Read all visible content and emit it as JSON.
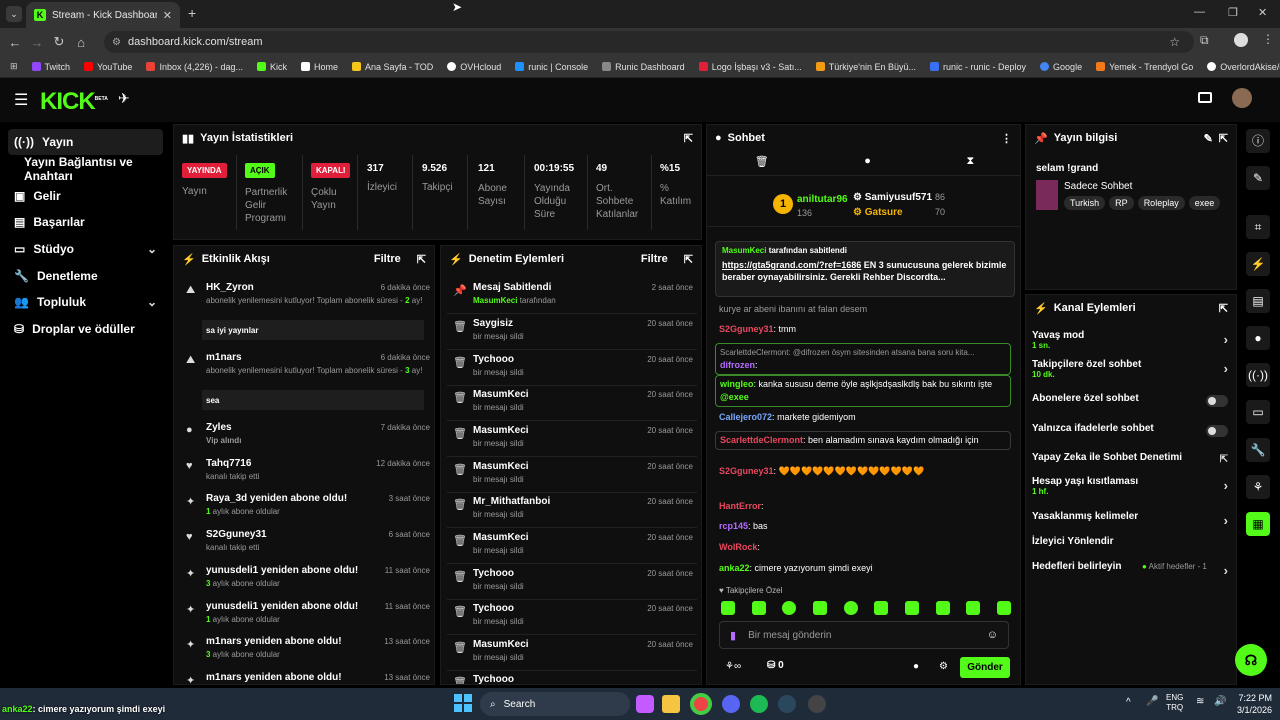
{
  "browser": {
    "tab_title": "Stream - Kick Dashboard",
    "url": "dashboard.kick.com/stream",
    "bookmarks": [
      "Twitch",
      "YouTube",
      "Inbox (4,226) - dag...",
      "Kick",
      "Home",
      "Ana Sayfa - TOD",
      "OVHcloud",
      "runic | Console",
      "Runic Dashboard",
      "Logo İşbaşı v3 - Satı...",
      "Türkiye'nin En Büyü...",
      "runic - runic - Deploy",
      "Google",
      "Yemek - Trendyol Go",
      "OverlordAkise/gmo..."
    ]
  },
  "kick": {
    "logo": "KICK",
    "logo_sup": "BETA"
  },
  "sidebar": {
    "items": [
      {
        "label": "Yayın",
        "icon": "broadcast-icon"
      },
      {
        "label": "Yayın Bağlantısı ve Anahtarı"
      },
      {
        "label": "Gelir",
        "icon": "revenue-icon"
      },
      {
        "label": "Başarılar",
        "icon": "achievements-icon"
      },
      {
        "label": "Stüdyo",
        "icon": "studio-icon"
      },
      {
        "label": "Denetleme",
        "icon": "wrench-icon"
      },
      {
        "label": "Topluluk",
        "icon": "community-icon"
      },
      {
        "label": "Droplar ve ödüller",
        "icon": "drops-icon"
      }
    ]
  },
  "stats": {
    "title": "Yayın İstatistikleri",
    "items": [
      {
        "badge": "YAYINDA",
        "badge_color": "#e21f3a",
        "label": "Yayın"
      },
      {
        "badge": "AÇIK",
        "badge_color": "#53fc18",
        "label": "Partnerlik Gelir Programı"
      },
      {
        "badge": "KAPALI",
        "badge_color": "#e21f3a",
        "label": "Çoklu Yayın"
      },
      {
        "value": "317",
        "label": "İzleyici"
      },
      {
        "value": "9.526",
        "label": "Takipçi"
      },
      {
        "value": "121",
        "label": "Abone Sayısı"
      },
      {
        "value": "00:19:55",
        "label": "Yayında Olduğu Süre"
      },
      {
        "value": "49",
        "label": "Ort. Sohbete Katılanlar"
      },
      {
        "value": "%15",
        "label": "% Katılım"
      }
    ]
  },
  "activity": {
    "title": "Etkinlik Akışı",
    "filter": "Filtre",
    "events": [
      {
        "name": "HK_Zyron",
        "time": "6 dakika önce",
        "sub_a": "abonelik yenilemesini kutluyor! Toplam abonelik süresi - ",
        "sub_num": "2",
        "sub_b": " ay!",
        "message": "sa iyi yayınlar"
      },
      {
        "name": "m1nars",
        "time": "6 dakika önce",
        "sub_a": "abonelik yenilemesini kutluyor! Toplam abonelik süresi - ",
        "sub_num": "3",
        "sub_b": " ay!",
        "message": "sea"
      },
      {
        "name": "Zyles",
        "time": "7 dakika önce",
        "sub": "Vip alındı"
      },
      {
        "name": "Tahq7716",
        "time": "12 dakika önce",
        "sub": "kanalı takip etti"
      },
      {
        "name": "Raya_3d yeniden abone oldu!",
        "time": "3 saat önce",
        "sub_num": "1",
        "sub": " aylık abone oldular"
      },
      {
        "name": "S2Gguney31",
        "time": "6 saat önce",
        "sub": "kanalı takip etti"
      },
      {
        "name": "yunusdeli1 yeniden abone oldu!",
        "time": "11 saat önce",
        "sub_num": "3",
        "sub": " aylık abone oldular"
      },
      {
        "name": "yunusdeli1 yeniden abone oldu!",
        "time": "11 saat önce",
        "sub_num": "1",
        "sub": " aylık abone oldular"
      },
      {
        "name": "m1nars yeniden abone oldu!",
        "time": "13 saat önce",
        "sub_num": "3",
        "sub": " aylık abone oldular"
      },
      {
        "name": "m1nars yeniden abone oldu!",
        "time": "13 saat önce"
      }
    ]
  },
  "moderation": {
    "title": "Denetim Eylemleri",
    "filter": "Filtre",
    "items": [
      {
        "name": "Mesaj Sabitlendi",
        "time": "2 saat önce",
        "by": "MasumKeci",
        "sub": " tarafından"
      },
      {
        "name": "Saygisiz",
        "time": "20 saat önce",
        "sub": "bir mesajı sildi"
      },
      {
        "name": "Tychooo",
        "time": "20 saat önce",
        "sub": "bir mesajı sildi"
      },
      {
        "name": "MasumKeci",
        "time": "20 saat önce",
        "sub": "bir mesajı sildi"
      },
      {
        "name": "MasumKeci",
        "time": "20 saat önce",
        "sub": "bir mesajı sildi"
      },
      {
        "name": "MasumKeci",
        "time": "20 saat önce",
        "sub": "bir mesajı sildi"
      },
      {
        "name": "Mr_Mithatfanboi",
        "time": "20 saat önce",
        "sub": "bir mesajı sildi"
      },
      {
        "name": "MasumKeci",
        "time": "20 saat önce",
        "sub": "bir mesajı sildi"
      },
      {
        "name": "Tychooo",
        "time": "20 saat önce",
        "sub": "bir mesajı sildi"
      },
      {
        "name": "Tychooo",
        "time": "20 saat önce",
        "sub": "bir mesajı sildi"
      },
      {
        "name": "MasumKeci",
        "time": "20 saat önce",
        "sub": "bir mesajı sildi"
      },
      {
        "name": "Tychooo",
        "time": "",
        "sub": ""
      }
    ]
  },
  "chat": {
    "title": "Sohbet",
    "leaders": {
      "first": "aniltutar96",
      "first_count": "136",
      "second": "Samiyusuf571",
      "second_count": "86",
      "third": "Gatsure",
      "third_count": "70",
      "rank": "1"
    },
    "pinned": {
      "by": "MasumKeci",
      "by_suffix": " tarafından sabitlendi",
      "link": "https://gta5grand.com/?ref=1686",
      "text": " EN 3 sunucusuna gelerek bizimle beraber oynayabilirsiniz. Gerekli Rehber Discordta..."
    },
    "messages": [
      {
        "user": "",
        "text": "kurye ar abeni ibanını at falan desem"
      },
      {
        "user": "S2Gguney31",
        "color": "#e8485f",
        "text": "tmm"
      },
      {
        "reply": "ScarlettdeClermont: @difrozen ösym sitesinden atsana bana soru kita...",
        "user": "difrozen",
        "color": "#b76bff",
        "text": ""
      },
      {
        "user": "wingleo",
        "color": "#53fc18",
        "text": "kanka sususu deme öyle aşlkjsdşaslkdlş bak bu sıkıntı işte ",
        "mention": "@exee",
        "highlight": true
      },
      {
        "user": "Callejero072",
        "color": "#7aa8ff",
        "text": "markete gidemiyom"
      },
      {
        "user": "ScarlettdeClermont",
        "color": "#e8485f",
        "text": "ben alamadım sınava kaydım olmadığı için"
      },
      {
        "user": "S2Gguney31",
        "color": "#e8485f",
        "text": "🧡🧡🧡🧡🧡🧡🧡🧡🧡🧡🧡🧡🧡"
      },
      {
        "user": "HantError",
        "color": "#e8485f",
        "text": ""
      },
      {
        "user": "rcp145",
        "color": "#b76bff",
        "text": "bas"
      },
      {
        "user": "WolRock",
        "color": "#e8485f",
        "text": ""
      },
      {
        "user": "anka22",
        "color": "#53fc18",
        "text": "cimere yazıyorum şimdi exeyi"
      }
    ],
    "emote_label": "Takipçilere Özel",
    "input_placeholder": "Bir mesaj gönderin",
    "points": "0",
    "send": "Gönder"
  },
  "stream_info": {
    "title": "Yayın bilgisi",
    "stream_title": "selam !grand",
    "category": "Sadece Sohbet",
    "tags": [
      "Turkish",
      "RP",
      "Roleplay",
      "exee"
    ]
  },
  "channel_actions": {
    "title": "Kanal Eylemleri",
    "items": [
      {
        "label": "Yavaş mod",
        "sub": "1 sn.",
        "control": "arrow"
      },
      {
        "label": "Takipçilere özel sohbet",
        "sub": "10 dk.",
        "control": "arrow"
      },
      {
        "label": "Abonelere özel sohbet",
        "control": "toggle"
      },
      {
        "label": "Yalnızca ifadelerle sohbet",
        "control": "toggle"
      },
      {
        "label": "Yapay Zeka ile Sohbet Denetimi",
        "control": "external"
      },
      {
        "label": "Hesap yaşı kısıtlaması",
        "sub": "1 hf.",
        "control": "arrow"
      },
      {
        "label": "Yasaklanmış kelimeler",
        "control": "arrow"
      },
      {
        "label": "İzleyici Yönlendir",
        "control": "none"
      },
      {
        "label": "Hedefleri belirleyin",
        "status": "Aktif hedefler - 1",
        "control": "arrow"
      }
    ]
  },
  "overlay_chat": {
    "user": "anka22",
    "text": "cimere yazıyorum şimdi exeyi"
  },
  "taskbar": {
    "search": "Search",
    "lang_a": "ENG",
    "lang_b": "TRQ",
    "time": "7:22 PM",
    "date": "3/1/2026"
  }
}
